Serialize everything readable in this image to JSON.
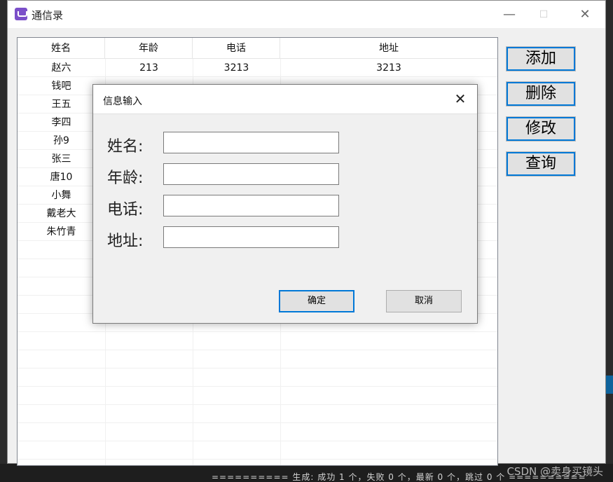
{
  "window": {
    "title": "通信录",
    "minimize_glyph": "—",
    "maximize_glyph": "☐",
    "close_glyph": "✕"
  },
  "table": {
    "headers": [
      "姓名",
      "年龄",
      "电话",
      "地址"
    ],
    "rows": [
      [
        "赵六",
        "213",
        "3213",
        "3213"
      ],
      [
        "钱吧",
        "",
        "",
        ""
      ],
      [
        "王五",
        "",
        "",
        ""
      ],
      [
        "李四",
        "",
        "",
        ""
      ],
      [
        "孙9",
        "",
        "",
        ""
      ],
      [
        "张三",
        "",
        "",
        ""
      ],
      [
        "唐10",
        "",
        "",
        ""
      ],
      [
        "小舞",
        "",
        "",
        ""
      ],
      [
        "戴老大",
        "",
        "",
        ""
      ],
      [
        "朱竹青",
        "",
        "",
        ""
      ]
    ]
  },
  "side_buttons": {
    "add": "添加",
    "delete": "删除",
    "modify": "修改",
    "query": "查询"
  },
  "dialog": {
    "title": "信息输入",
    "close_glyph": "✕",
    "fields": {
      "name_label": "姓名:",
      "age_label": "年龄:",
      "phone_label": "电话:",
      "address_label": "地址:",
      "name_value": "",
      "age_value": "",
      "phone_value": "",
      "address_value": ""
    },
    "ok": "确定",
    "cancel": "取消"
  },
  "background": {
    "build_output": "========== 生成: 成功 1 个，失败 0 个，最新 0 个，跳过 0 个 ==========",
    "watermark": "CSDN @卖身买镜头"
  }
}
